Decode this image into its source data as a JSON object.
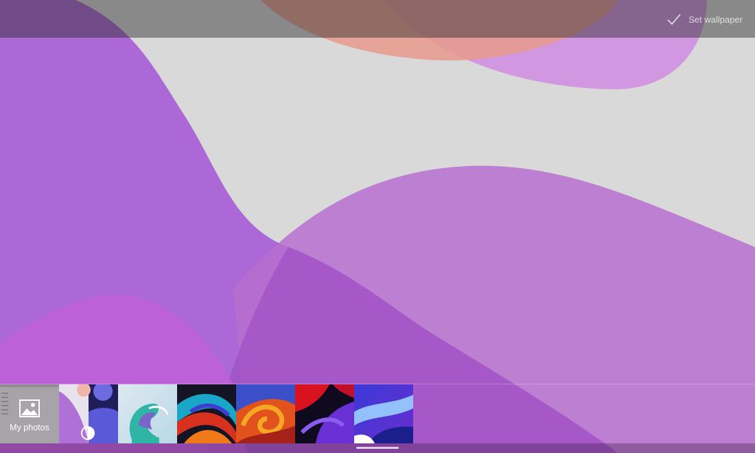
{
  "toolbar": {
    "set_wallpaper_label": "Set wallpaper",
    "set_wallpaper_icon": "check-icon"
  },
  "strip": {
    "my_photos_label": "My photos",
    "my_photos_icon": "image-icon",
    "theme_toggle_icon": "contrast-icon",
    "thumbnails": [
      "wallpaper-purple-waves",
      "wallpaper-teal-swirl",
      "wallpaper-red-blue-swirl",
      "wallpaper-orange-swirl",
      "wallpaper-red-purple-ribbons",
      "wallpaper-blue-ribbons"
    ]
  },
  "colors": {
    "accent_purple": "#b06ad8",
    "background_gray": "#d9d9d9"
  }
}
